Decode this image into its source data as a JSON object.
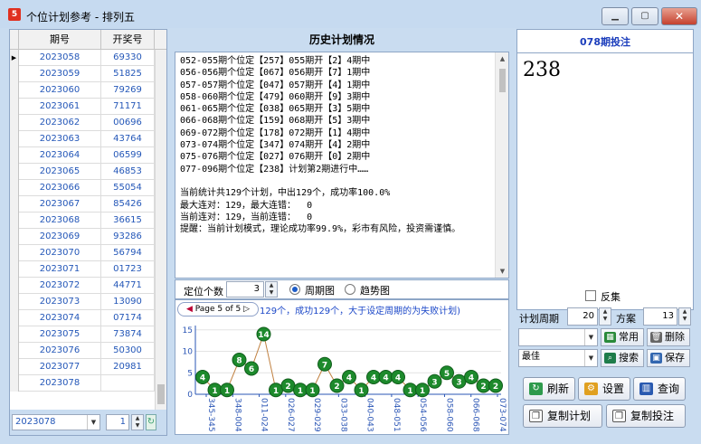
{
  "window": {
    "title": "个位计划参考 - 排列五",
    "app_icon": "lottery-app-icon",
    "minimize_icon": "minimize-icon",
    "maximize_icon": "maximize-icon",
    "close_icon": "close-icon"
  },
  "grid": {
    "col_issue": "期号",
    "col_number": "开奖号",
    "rows": [
      {
        "issue": "2023058",
        "number": "69330"
      },
      {
        "issue": "2023059",
        "number": "51825"
      },
      {
        "issue": "2023060",
        "number": "79269"
      },
      {
        "issue": "2023061",
        "number": "71171"
      },
      {
        "issue": "2023062",
        "number": "00696"
      },
      {
        "issue": "2023063",
        "number": "43764"
      },
      {
        "issue": "2023064",
        "number": "06599"
      },
      {
        "issue": "2023065",
        "number": "46853"
      },
      {
        "issue": "2023066",
        "number": "55054"
      },
      {
        "issue": "2023067",
        "number": "85426"
      },
      {
        "issue": "2023068",
        "number": "36615"
      },
      {
        "issue": "2023069",
        "number": "93286"
      },
      {
        "issue": "2023070",
        "number": "56794"
      },
      {
        "issue": "2023071",
        "number": "01723"
      },
      {
        "issue": "2023072",
        "number": "44771"
      },
      {
        "issue": "2023073",
        "number": "13090"
      },
      {
        "issue": "2023074",
        "number": "07174"
      },
      {
        "issue": "2023075",
        "number": "73874"
      },
      {
        "issue": "2023076",
        "number": "50300"
      },
      {
        "issue": "2023077",
        "number": "20981"
      },
      {
        "issue": "2023078",
        "number": ""
      }
    ],
    "current_row_marker": "▶",
    "issue_select": "2023078",
    "count_value": "1"
  },
  "history": {
    "title": "历史计划情况",
    "lines": [
      "052-055期个位定【257】055期开【2】4期中",
      "056-056期个位定【067】056期开【7】1期中",
      "057-057期个位定【047】057期开【4】1期中",
      "058-060期个位定【479】060期开【9】3期中",
      "061-065期个位定【038】065期开【3】5期中",
      "066-068期个位定【159】068期开【5】3期中",
      "069-072期个位定【178】072期开【1】4期中",
      "073-074期个位定【347】074期开【4】2期中",
      "075-076期个位定【027】076期开【0】2期中",
      "077-096期个位定【238】计划第2期进行中……",
      "",
      "当前统计共129个计划，中出129个，成功率100.0%",
      "最大连对：129，最大连错：  0",
      "当前连对：129，当前连错：  0",
      "提醒：当前计划模式，理论成功率99.9%，彩市有风险，投资需谨慎。"
    ]
  },
  "options": {
    "digits_label": "定位个数",
    "digits_value": "3",
    "cycle_chart_label": "周期图",
    "trend_chart_label": "趋势图"
  },
  "chart_data": {
    "type": "line",
    "pager": "Page 5 of 5",
    "note": "129个，成功129个，大于设定周期的为失败计划)",
    "categories": [
      "345-345",
      "348-004",
      "011-024",
      "026-027",
      "029-029",
      "033-038",
      "040-043",
      "048-051",
      "054-056",
      "058-060",
      "066-068",
      "073-074"
    ],
    "values": [
      4,
      1,
      1,
      8,
      6,
      14,
      1,
      2,
      1,
      1,
      7,
      2,
      4,
      1,
      4,
      4,
      4,
      1,
      1,
      3,
      5,
      3,
      4,
      2,
      2
    ],
    "yticks": [
      0,
      5,
      10,
      15
    ],
    "ylim": [
      0,
      16
    ],
    "grid": true
  },
  "bet": {
    "title": "078期投注",
    "value": "238"
  },
  "controls": {
    "reverse_label": "反集",
    "cycle_label": "计划周期",
    "cycle_value": "20",
    "scheme_label": "方案",
    "scheme_value": "13",
    "common_label": "常用",
    "delete_label": "删除",
    "best_select": "最佳",
    "search_label": "搜索",
    "save_label": "保存",
    "refresh_label": "刷新",
    "settings_label": "设置",
    "query_label": "查询",
    "copy_plan_label": "复制计划",
    "copy_bet_label": "复制投注"
  }
}
